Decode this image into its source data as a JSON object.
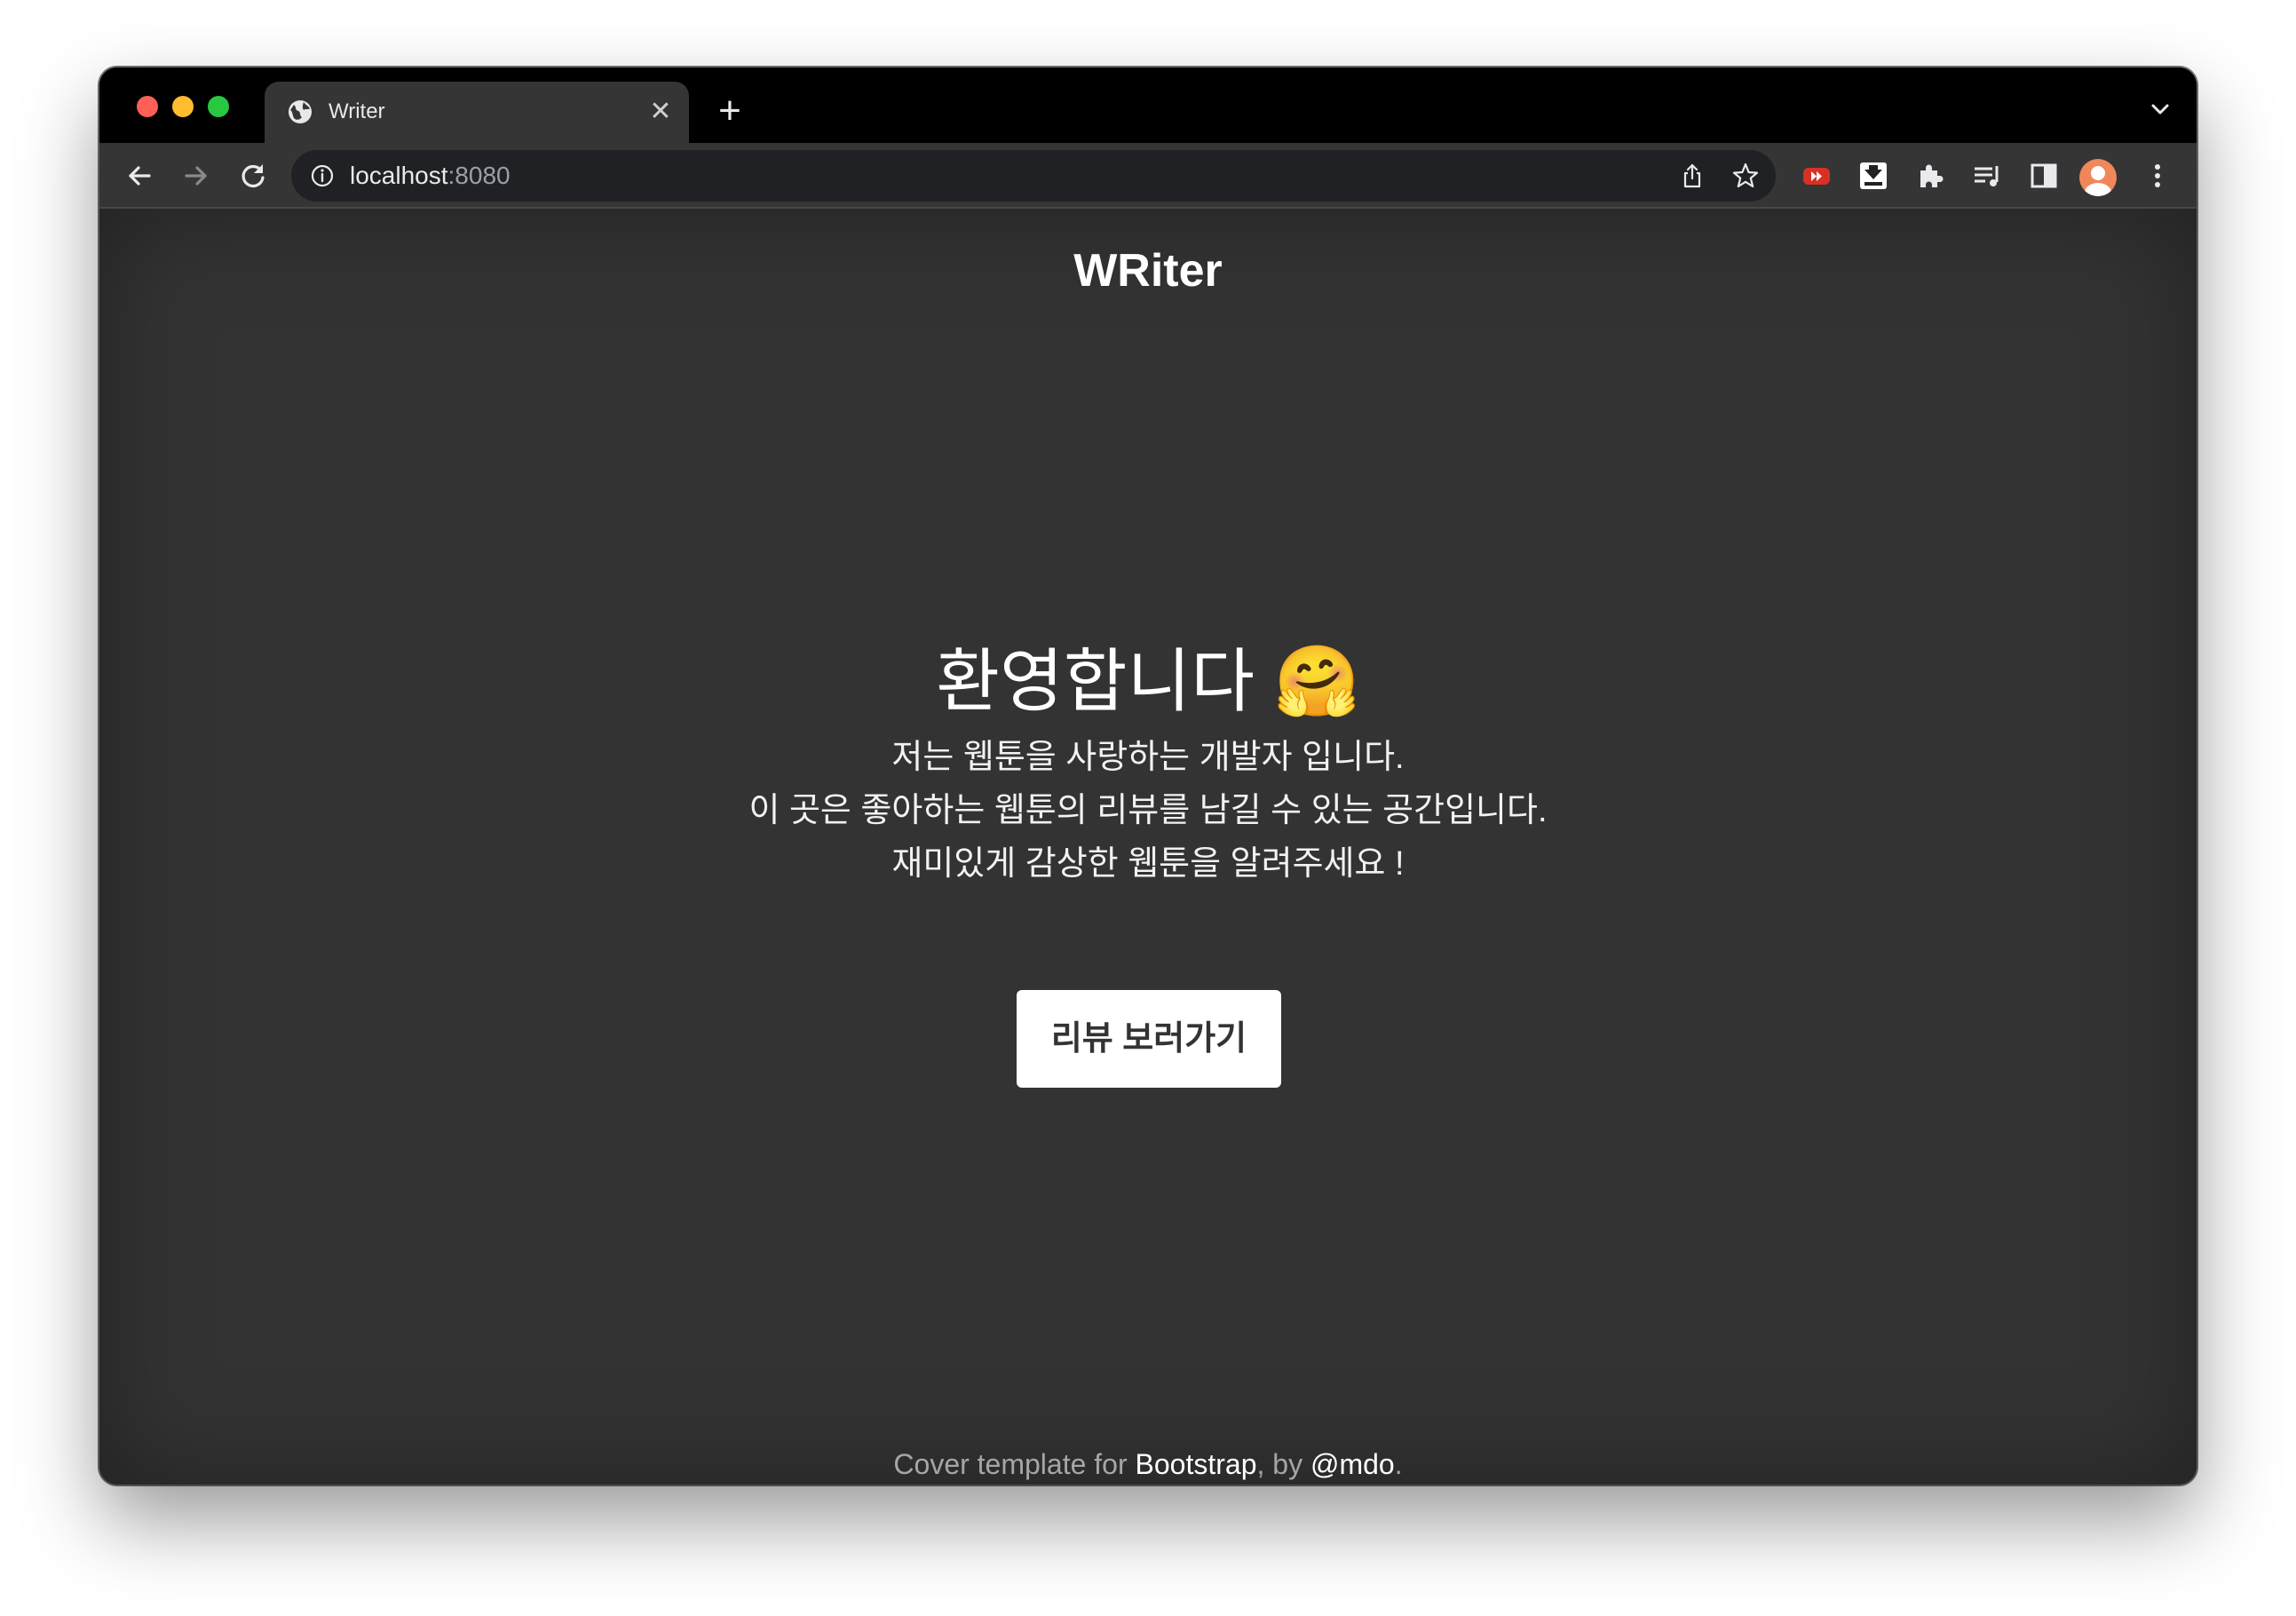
{
  "browser": {
    "tab": {
      "title": "Writer"
    },
    "address": {
      "host": "localhost",
      "port": ":8080"
    }
  },
  "page": {
    "brand": "WRiter",
    "hero": {
      "title": "환영합니다 🤗",
      "lines": [
        "저는 웹툰을 사랑하는 개발자 입니다.",
        "이 곳은 좋아하는 웹툰의 리뷰를 남길 수 있는 공간입니다.",
        "재미있게 감상한 웹툰을 알려주세요 !"
      ],
      "cta_label": "리뷰 보러가기"
    },
    "footer": {
      "prefix": "Cover template for ",
      "link1": "Bootstrap",
      "middle": ", by ",
      "link2": "@mdo",
      "suffix": "."
    }
  },
  "colors": {
    "page_background": "#333333",
    "titlebar": "#000000",
    "toolbar": "#353535",
    "omnibox": "#202124",
    "traffic_red": "#fe5f57",
    "traffic_yellow": "#febc2e",
    "traffic_green": "#28c840",
    "button_bg": "#ffffff"
  },
  "icons": {
    "tab": "globe-icon",
    "nav": [
      "back-arrow-icon",
      "forward-arrow-icon",
      "reload-icon"
    ],
    "omnibox": [
      "info-icon",
      "share-icon",
      "star-icon"
    ],
    "extensions": [
      "youtube-extension-icon",
      "download-extension-icon",
      "puzzle-extensions-icon",
      "media-queue-icon",
      "side-panel-icon",
      "profile-avatar",
      "more-menu-icon"
    ]
  }
}
